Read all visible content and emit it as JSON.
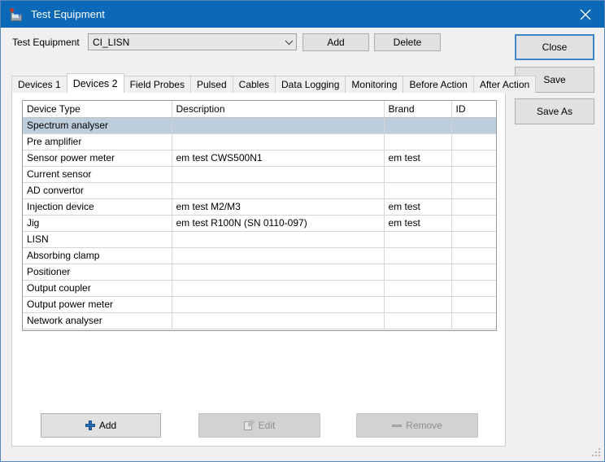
{
  "window": {
    "title": "Test Equipment",
    "app_icon": "computer-network-icon",
    "close_icon": "close-icon",
    "titlebar_color": "#0c69b8",
    "background_color": "#f0f0f0"
  },
  "toolbar": {
    "equipment_label": "Test Equipment",
    "equipment_value": "CI_LISN",
    "equipment_dropdown_icon": "chevron-down-icon",
    "add_label": "Add",
    "delete_label": "Delete"
  },
  "side_buttons": {
    "close_label": "Close",
    "save_label": "Save",
    "save_as_label": "Save As",
    "focus_color": "#3c85c8"
  },
  "tabs": [
    {
      "label": "Devices 1",
      "active": false
    },
    {
      "label": "Devices 2",
      "active": true
    },
    {
      "label": "Field Probes",
      "active": false
    },
    {
      "label": "Pulsed",
      "active": false
    },
    {
      "label": "Cables",
      "active": false
    },
    {
      "label": "Data Logging",
      "active": false
    },
    {
      "label": "Monitoring",
      "active": false
    },
    {
      "label": "Before Action",
      "active": false
    },
    {
      "label": "After Action",
      "active": false
    }
  ],
  "grid": {
    "columns": [
      "Device Type",
      "Description",
      "Brand",
      "ID"
    ],
    "selection_color": "#bdcddb",
    "rows": [
      {
        "device_type": "Spectrum analyser",
        "description": "",
        "brand": "",
        "id": "",
        "selected": true
      },
      {
        "device_type": "Pre amplifier",
        "description": "",
        "brand": "",
        "id": "",
        "selected": false
      },
      {
        "device_type": "Sensor power meter",
        "description": "em test CWS500N1",
        "brand": "em test",
        "id": "",
        "selected": false
      },
      {
        "device_type": "Current sensor",
        "description": "",
        "brand": "",
        "id": "",
        "selected": false
      },
      {
        "device_type": "AD convertor",
        "description": "",
        "brand": "",
        "id": "",
        "selected": false
      },
      {
        "device_type": "Injection device",
        "description": "em test M2/M3",
        "brand": "em test",
        "id": "",
        "selected": false
      },
      {
        "device_type": "Jig",
        "description": "em test R100N (SN 0110-097)",
        "brand": "em test",
        "id": "",
        "selected": false
      },
      {
        "device_type": "LISN",
        "description": "",
        "brand": "",
        "id": "",
        "selected": false
      },
      {
        "device_type": "Absorbing clamp",
        "description": "",
        "brand": "",
        "id": "",
        "selected": false
      },
      {
        "device_type": "Positioner",
        "description": "",
        "brand": "",
        "id": "",
        "selected": false
      },
      {
        "device_type": "Output coupler",
        "description": "",
        "brand": "",
        "id": "",
        "selected": false
      },
      {
        "device_type": "Output power meter",
        "description": "",
        "brand": "",
        "id": "",
        "selected": false
      },
      {
        "device_type": "Network analyser",
        "description": "",
        "brand": "",
        "id": "",
        "selected": false
      }
    ]
  },
  "bottom_buttons": {
    "add_label": "Add",
    "add_icon": "plus-icon",
    "edit_label": "Edit",
    "edit_icon": "edit-pencil-icon",
    "remove_label": "Remove",
    "remove_icon": "minus-icon"
  }
}
